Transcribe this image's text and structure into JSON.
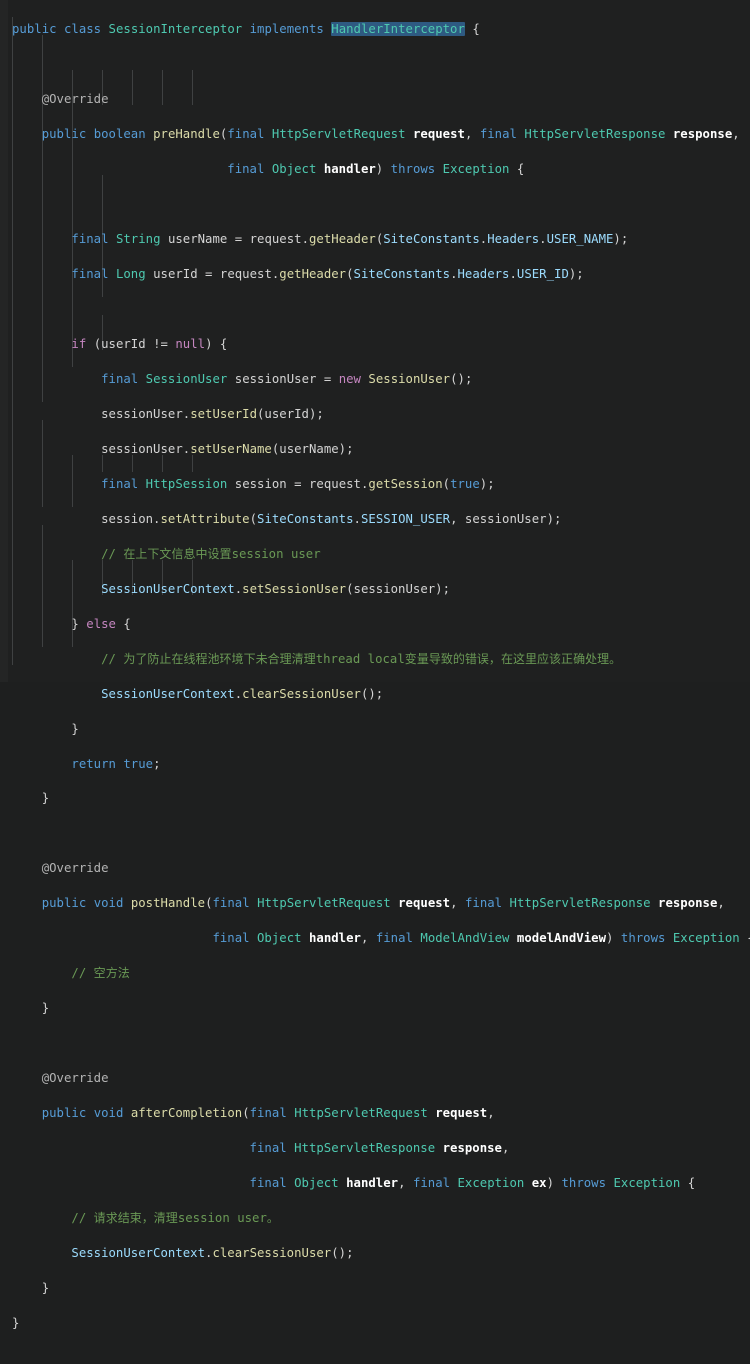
{
  "editor": {
    "language": "java",
    "file_name": "SessionInterceptor.java",
    "background_color": "#1f2020",
    "gutter_color": "#242525",
    "indent_guide_color": "#3f4142",
    "selection_color": "#2e5a82",
    "font_size_px": 12.3,
    "line_height_px": 17.48,
    "theme_colors": {
      "keyword": "#569cd6",
      "control_keyword": "#c586c0",
      "type": "#4ec9b0",
      "function": "#dcdcaa",
      "variable": "#9cdcfe",
      "comment": "#6a9955",
      "annotation": "#b4b4b4",
      "parameter": "#ffffff",
      "punctuation": "#d4d4d4"
    },
    "selected_text": "HandlerInterceptor"
  },
  "code": {
    "lines": [
      "public class SessionInterceptor implements HandlerInterceptor {",
      "",
      "    @Override",
      "    public boolean preHandle(final HttpServletRequest request, final HttpServletResponse response,",
      "                             final Object handler) throws Exception {",
      "",
      "        final String userName = request.getHeader(SiteConstants.Headers.USER_NAME);",
      "        final Long userId = request.getHeader(SiteConstants.Headers.USER_ID);",
      "",
      "        if (userId != null) {",
      "            final SessionUser sessionUser = new SessionUser();",
      "            sessionUser.setUserId(userId);",
      "            sessionUser.setUserName(userName);",
      "            final HttpSession session = request.getSession(true);",
      "            session.setAttribute(SiteConstants.SESSION_USER, sessionUser);",
      "            // 在上下文信息中设置session user",
      "            SessionUserContext.setSessionUser(sessionUser);",
      "        } else {",
      "            // 为了防止在线程池环境下未合理清理thread local变量导致的错误，在这里应该正确处理。",
      "            SessionUserContext.clearSessionUser();",
      "        }",
      "        return true;",
      "    }",
      "",
      "    @Override",
      "    public void postHandle(final HttpServletRequest request, final HttpServletResponse response,",
      "                           final Object handler, final ModelAndView modelAndView) throws Exception {",
      "        // 空方法",
      "    }",
      "",
      "    @Override",
      "    public void afterCompletion(final HttpServletRequest request,",
      "                                final HttpServletResponse response,",
      "                                final Object handler, final Exception ex) throws Exception {",
      "        // 请求结束，清理session user。",
      "        SessionUserContext.clearSessionUser();",
      "    }",
      "}"
    ],
    "comments": [
      "// 在上下文信息中设置session user",
      "// 为了防止在线程池环境下未合理清理thread local变量导致的错误，在这里应该正确处理。",
      "// 空方法",
      "// 请求结束，清理session user。"
    ],
    "class_name": "SessionInterceptor",
    "implements": "HandlerInterceptor",
    "methods": [
      "preHandle",
      "postHandle",
      "afterCompletion"
    ],
    "annotations": [
      "@Override",
      "@Override",
      "@Override"
    ]
  }
}
